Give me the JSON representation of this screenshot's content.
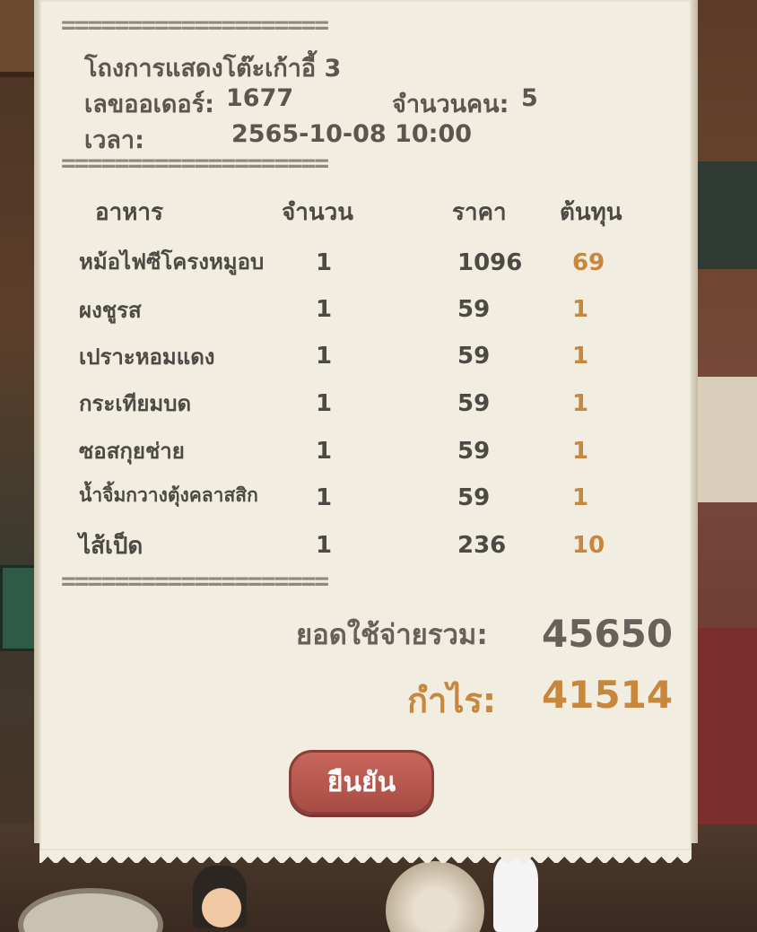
{
  "header": {
    "table_name": "โถงการแสดงโต๊ะเก้าอี้ 3",
    "order_label": "เลขออเดอร์:",
    "order_number": "1677",
    "guests_label": "จำนวนคน:",
    "guests_count": "5",
    "time_label": "เวลา:",
    "time_value": "2565-10-08 10:00"
  },
  "divider": "====================",
  "columns": {
    "food": "อาหาร",
    "quantity": "จำนวน",
    "price": "ราคา",
    "cost": "ต้นทุน"
  },
  "items": [
    {
      "name": "หม้อไฟซีโครงหมูอบ",
      "qty": "1",
      "price": "1096",
      "cost": "69"
    },
    {
      "name": "ผงชูรส",
      "qty": "1",
      "price": "59",
      "cost": "1"
    },
    {
      "name": "เปราะหอมแดง",
      "qty": "1",
      "price": "59",
      "cost": "1"
    },
    {
      "name": "กระเทียมบด",
      "qty": "1",
      "price": "59",
      "cost": "1"
    },
    {
      "name": "ซอสกุยช่าย",
      "qty": "1",
      "price": "59",
      "cost": "1"
    },
    {
      "name": "น้ำจิ้มกวางตุ้งคลาสสิก",
      "qty": "1",
      "price": "59",
      "cost": "1"
    },
    {
      "name": "ไส้เป็ด",
      "qty": "1",
      "price": "236",
      "cost": "10"
    }
  ],
  "summary": {
    "total_label": "ยอดใช้จ่ายรวม:",
    "total_value": "45650",
    "profit_label": "กำไร:",
    "profit_value": "41514"
  },
  "confirm_label": "ยืนยัน",
  "colors": {
    "paper": "#f1ede0",
    "text": "#4d4944",
    "accent": "#c7873d",
    "button": "#b5554c"
  }
}
